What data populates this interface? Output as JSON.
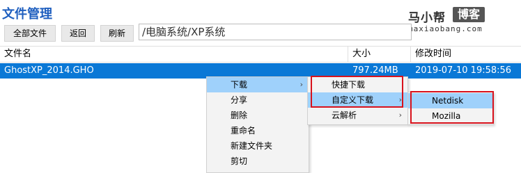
{
  "app": {
    "title": "文件管理"
  },
  "logo": {
    "brand": "马小帮",
    "badge": "博客",
    "domain": "maxiaobang.com"
  },
  "toolbar": {
    "all_files_label": "全部文件",
    "back_label": "返回",
    "refresh_label": "刷新",
    "path_value": "/电脑系统/XP系统"
  },
  "table": {
    "columns": [
      "文件名",
      "大小",
      "修改时间"
    ],
    "rows": [
      {
        "name": "GhostXP_2014.GHO",
        "size": "797.24MB",
        "modified": "2019-07-10 19:58:56"
      }
    ]
  },
  "context_menu": {
    "items": [
      "下载",
      "分享",
      "删除",
      "重命名",
      "新建文件夹",
      "剪切"
    ],
    "highlighted": "下载"
  },
  "download_submenu": {
    "items": [
      "快捷下载",
      "自定义下载",
      "云解析"
    ],
    "highlighted": "自定义下载"
  },
  "custom_download_submenu": {
    "items": [
      "Netdisk",
      "Mozilla"
    ],
    "highlighted": "Netdisk"
  },
  "colors": {
    "title": "#1f5fbf",
    "selection": "#0a78d6",
    "menu_highlight": "#9fd1fb",
    "annotation_red": "#d8121c"
  }
}
